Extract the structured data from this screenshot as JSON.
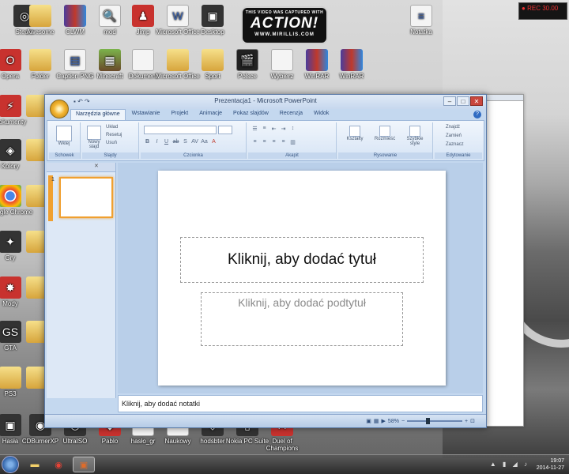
{
  "desktop": {
    "icons_top": [
      "Steam",
      "Awesome",
      "CLWM",
      "mod",
      "Jimp",
      "Microsoft Office",
      "Desktop",
      "",
      "Notatka"
    ],
    "icons_row2": [
      "Opera",
      "Folder",
      "Caption PNG",
      "Minecraft",
      "Dokument",
      "Microsoft Office",
      "Sport",
      "Polsce",
      "Wybierz",
      "WinRAR"
    ],
    "icons_left": [
      "Dokumenty",
      "Kolory",
      "Przegląd",
      "Google Chrome",
      "Gry",
      "Mody",
      "GTA",
      "PS3",
      "Mod"
    ],
    "icons_bottom": [
      "Hasła",
      "CDBurnerXP",
      "UltraISO",
      "Pablo",
      "hasło_gr",
      "Naukowy",
      "hodsbter",
      "Nokia PC Suite",
      "Duel of Champions"
    ],
    "notepad_label": "Notatka"
  },
  "watermark": {
    "top": "THIS VIDEO WAS CAPTURED WITH",
    "brand": "ACTION!",
    "url": "WWW.MIRILLIS.COM"
  },
  "recording": {
    "label": "REC",
    "value": "30.00"
  },
  "ppt": {
    "window_title": "Prezentacja1 - Microsoft PowerPoint",
    "tabs": [
      "Narzędzia główne",
      "Wstawianie",
      "Projekt",
      "Animacje",
      "Pokaz slajdów",
      "Recenzja",
      "Widok"
    ],
    "groups": [
      "Schowek",
      "Slajdy",
      "Czcionka",
      "Akapit",
      "Rysowanie",
      "Edytowanie"
    ],
    "clipboard_btn": "Wklej",
    "slides_btns": [
      "Nowy slajd",
      "Układ",
      "Resetuj",
      "Usuń"
    ],
    "drawing_btns": [
      "Kształty",
      "Rozmieść",
      "Szybkie style"
    ],
    "editing_btns": [
      "Znajdź",
      "Zamień",
      "Zaznacz"
    ],
    "thumb_number": "1",
    "title_placeholder": "Kliknij, aby dodać tytuł",
    "subtitle_placeholder": "Kliknij, aby dodać podtytuł",
    "notes_placeholder": "Kliknij, aby dodać notatki",
    "zoom_level": "58%"
  },
  "taskbar": {
    "time": "19:07",
    "date": "2014-11-27"
  }
}
